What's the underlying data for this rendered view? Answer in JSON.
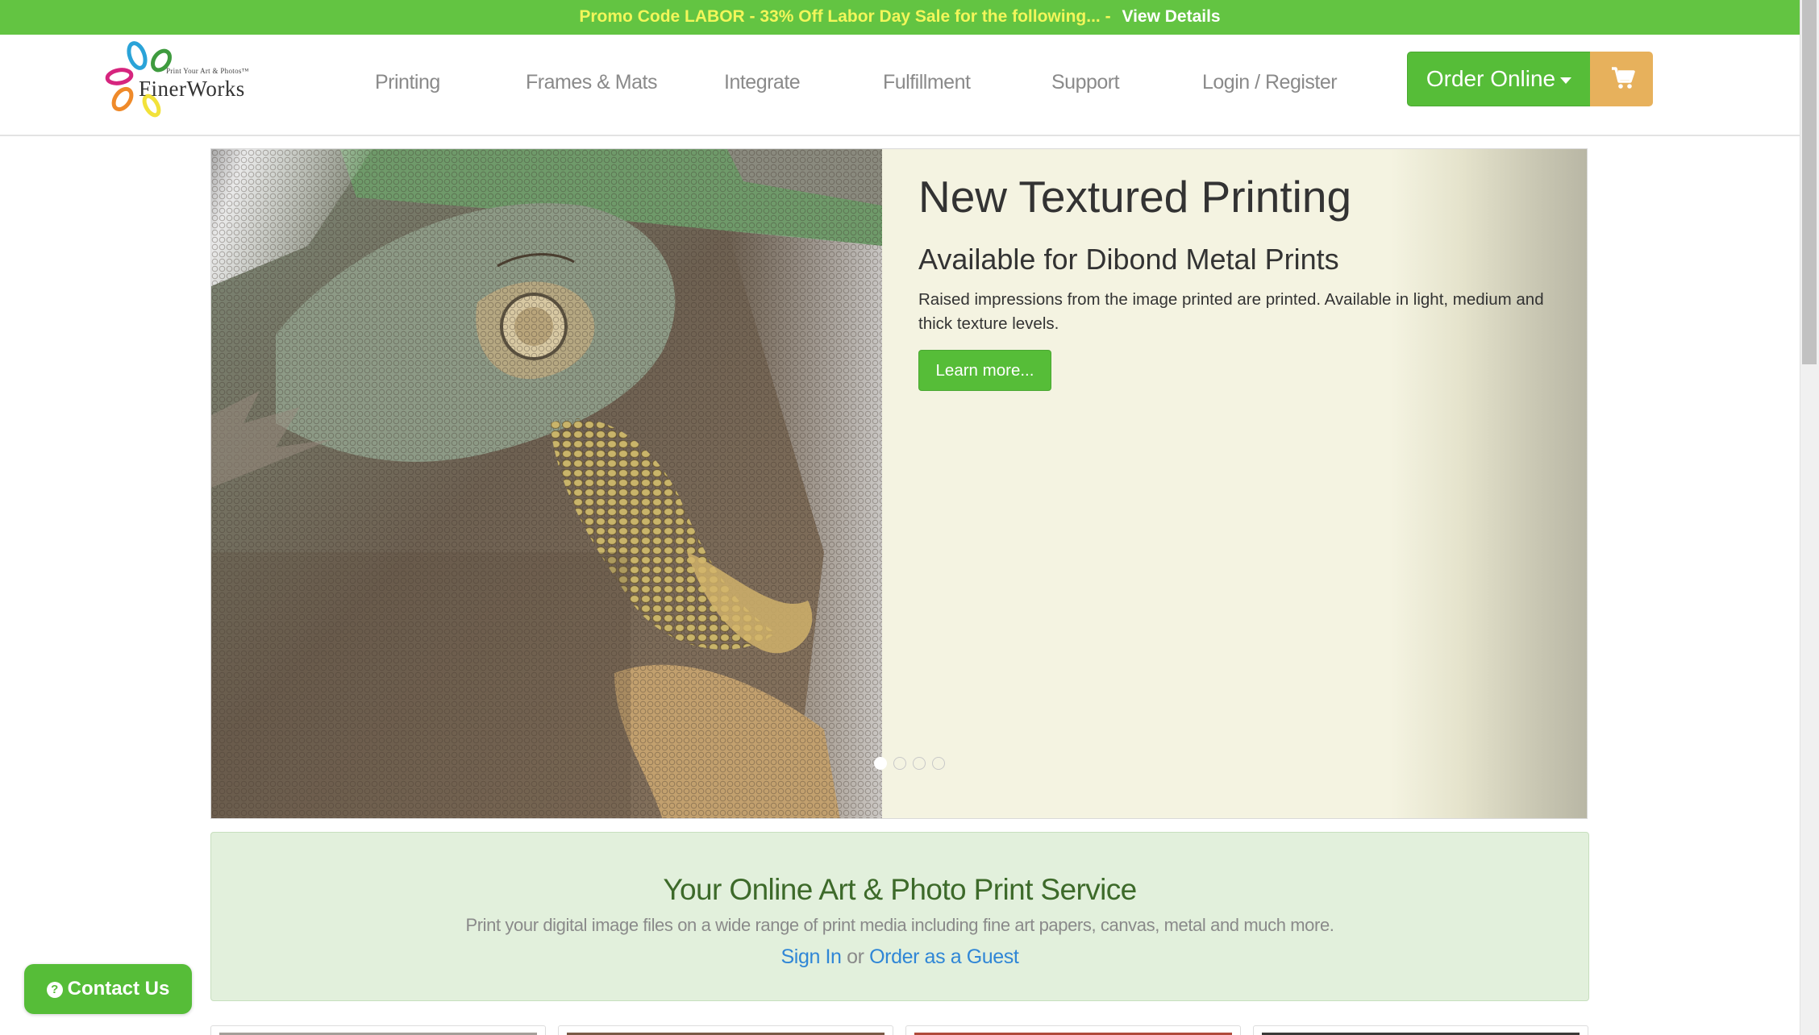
{
  "promo": {
    "message": "Promo Code LABOR - 33% Off Labor Day Sale for the following... -",
    "link": "View Details"
  },
  "logo": {
    "tagline": "Print Your Art & Photos™",
    "name": "FinerWorks"
  },
  "nav": {
    "items": [
      {
        "label": "Printing"
      },
      {
        "label": "Frames & Mats"
      },
      {
        "label": "Integrate"
      },
      {
        "label": "Fulfillment"
      },
      {
        "label": "Support"
      },
      {
        "label": "Login / Register"
      }
    ],
    "order_label": "Order Online",
    "cart_icon": "shopping-cart-icon"
  },
  "hero": {
    "title": "New Textured Printing",
    "subtitle": "Available for Dibond Metal Prints",
    "description": "Raised impressions from the image printed are printed. Available in light, medium and thick texture levels.",
    "button": "Learn more...",
    "slide_count": 4,
    "active_slide": 1
  },
  "intro": {
    "title": "Your Online Art & Photo Print Service",
    "description": "Print your digital image files on a wide range of print media including fine art papers, canvas, metal and much more.",
    "sign_in": "Sign In",
    "or": "or",
    "guest": "Order as a Guest"
  },
  "contact": {
    "label": "Contact Us",
    "icon": "question-circle-icon"
  },
  "colors": {
    "promo_bg": "#63c442",
    "promo_text": "#f2f65a",
    "brand_green": "#56bd38",
    "cart_orange": "#e7b15c",
    "link_blue": "#2f86d6",
    "intro_bg": "#e2f0dc",
    "intro_title": "#3d6a2a"
  }
}
